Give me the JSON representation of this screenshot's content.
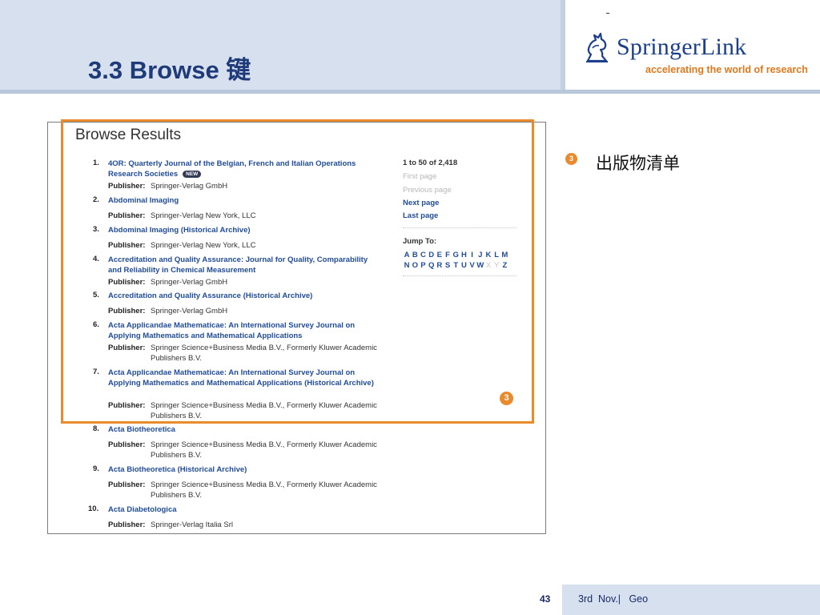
{
  "slide": {
    "title": "3.3 Browse 键",
    "logo_name": "SpringerLink",
    "logo_tagline": "accelerating the world of research",
    "bullet_marker": "3",
    "bullet_text": "出版物清单",
    "page_number": "43",
    "footer_text": "3rd  Nov.|   Geo"
  },
  "browse": {
    "heading": "Browse Results",
    "publisher_label": "Publisher:",
    "new_badge": "NEW",
    "marker": "3",
    "results": [
      {
        "num": "1.",
        "title": "4OR: Quarterly Journal of the Belgian, French and Italian Operations Research Societies",
        "publisher": "Springer-Verlag GmbH"
      },
      {
        "num": "2.",
        "title": "Abdominal Imaging",
        "publisher": "Springer-Verlag New York, LLC"
      },
      {
        "num": "3.",
        "title": "Abdominal Imaging (Historical Archive)",
        "publisher": "Springer-Verlag New York, LLC"
      },
      {
        "num": "4.",
        "title": "Accreditation and Quality Assurance: Journal for Quality, Comparability and Reliability in Chemical Measurement",
        "publisher": "Springer-Verlag GmbH"
      },
      {
        "num": "5.",
        "title": "Accreditation and Quality Assurance (Historical Archive)",
        "publisher": "Springer-Verlag GmbH"
      },
      {
        "num": "6.",
        "title": "Acta Applicandae Mathematicae: An International Survey Journal on Applying Mathematics and Mathematical Applications",
        "publisher": "Springer Science+Business Media B.V., Formerly Kluwer Academic Publishers B.V."
      },
      {
        "num": "7.",
        "title": "Acta Applicandae Mathematicae: An International Survey Journal on Applying Mathematics and Mathematical Applications (Historical Archive)",
        "publisher": "Springer Science+Business Media B.V., Formerly Kluwer Academic Publishers B.V."
      },
      {
        "num": "8.",
        "title": "Acta Biotheoretica",
        "publisher": "Springer Science+Business Media B.V., Formerly Kluwer Academic Publishers B.V."
      },
      {
        "num": "9.",
        "title": "Acta Biotheoretica (Historical Archive)",
        "publisher": "Springer Science+Business Media B.V., Formerly Kluwer Academic Publishers B.V."
      },
      {
        "num": "10.",
        "title": "Acta Diabetologica",
        "publisher": "Springer-Verlag Italia Srl"
      }
    ],
    "sidebar": {
      "count": "1 to 50 of 2,418",
      "first_page": "First page",
      "previous_page": "Previous page",
      "next_page": "Next page",
      "last_page": "Last page",
      "jump_to": "Jump To:",
      "letters_row1": [
        "A",
        "B",
        "C",
        "D",
        "E",
        "F",
        "G",
        "H",
        "I",
        "J",
        "K",
        "L",
        "M"
      ],
      "letters_row2": [
        "N",
        "O",
        "P",
        "Q",
        "R",
        "S",
        "T",
        "U",
        "V",
        "W",
        "X",
        "Y",
        "Z"
      ],
      "dim_letters": [
        "X",
        "Y"
      ]
    }
  },
  "colors": {
    "title": "#1f3a78",
    "link": "#1f4b9b",
    "accent_orange": "#e98a2c",
    "header_band": "#d6e0ee"
  }
}
